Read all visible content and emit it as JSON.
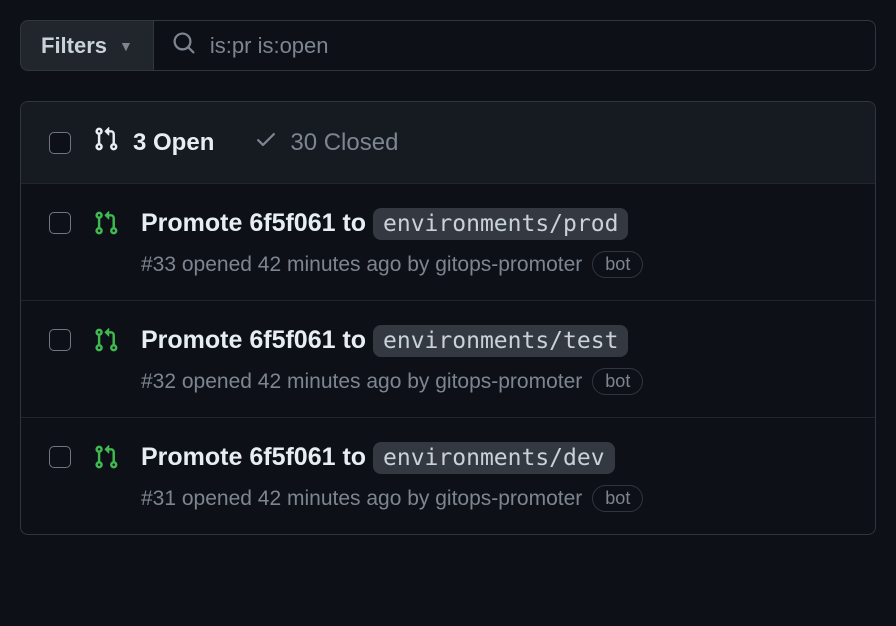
{
  "filters": {
    "label": "Filters"
  },
  "search": {
    "value": "is:pr is:open"
  },
  "header": {
    "open_count": "3 Open",
    "closed_count": "30 Closed"
  },
  "prs": [
    {
      "title_prefix": "Promote 6f5f061 to ",
      "code": "environments/prod",
      "meta_prefix": "#33 opened 42 minutes ago by gitops-promoter",
      "bot": "bot"
    },
    {
      "title_prefix": "Promote 6f5f061 to ",
      "code": "environments/test",
      "meta_prefix": "#32 opened 42 minutes ago by gitops-promoter",
      "bot": "bot"
    },
    {
      "title_prefix": "Promote 6f5f061 to ",
      "code": "environments/dev",
      "meta_prefix": "#31 opened 42 minutes ago by gitops-promoter",
      "bot": "bot"
    }
  ]
}
